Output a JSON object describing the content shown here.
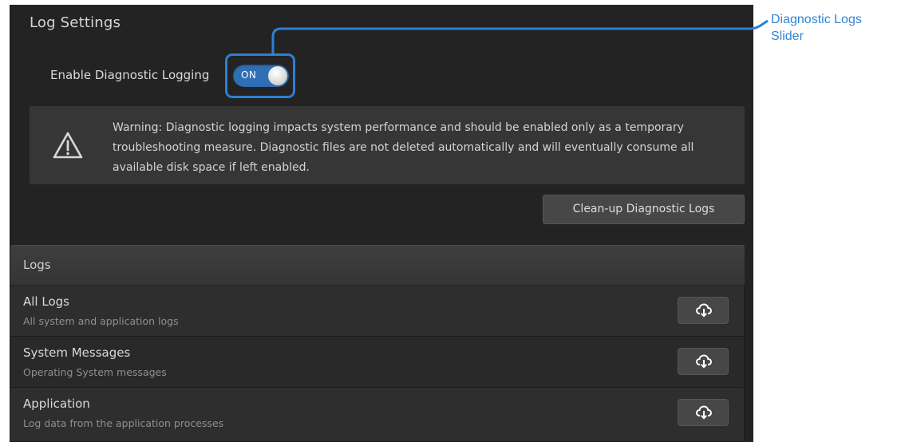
{
  "log_settings": {
    "title": "Log Settings",
    "enable_label": "Enable Diagnostic Logging",
    "toggle": {
      "state_label": "ON",
      "on": true
    },
    "warning": {
      "icon": "warning-triangle-icon",
      "text": "Warning: Diagnostic logging impacts system performance and should be enabled only as a temporary troubleshooting measure. Diagnostic files are not deleted automatically and will eventually consume all available disk space if left enabled."
    },
    "cleanup_button": "Clean-up Diagnostic Logs"
  },
  "logs": {
    "header": "Logs",
    "items": [
      {
        "title": "All Logs",
        "description": "All system and application logs",
        "icon": "cloud-download-icon"
      },
      {
        "title": "System Messages",
        "description": "Operating System messages",
        "icon": "cloud-download-icon"
      },
      {
        "title": "Application",
        "description": "Log data from the application processes",
        "icon": "cloud-download-icon"
      }
    ]
  },
  "annotation": {
    "line1": "Diagnostic Logs",
    "line2": "Slider"
  },
  "colors": {
    "panel_bg": "#232323",
    "accent_blue": "#2f6fb6",
    "callout_blue": "#2f86d6"
  }
}
